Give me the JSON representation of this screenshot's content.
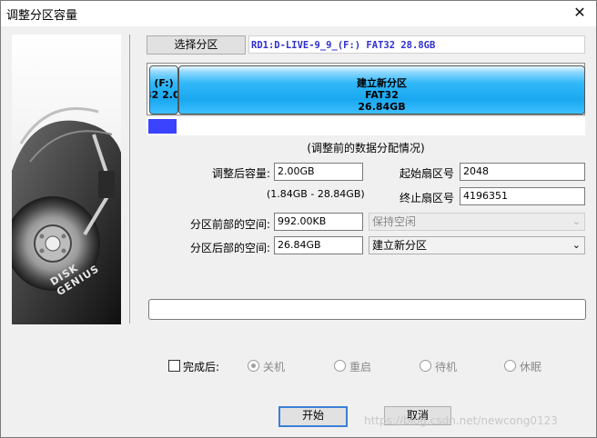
{
  "window": {
    "title": "调整分区容量",
    "close_glyph": "✕"
  },
  "art": {
    "logo_text": "DISK GENIUS"
  },
  "top": {
    "select_partition_label": "选择分区",
    "partition_path": "RD1:D-LIVE-9_9_(F:) FAT32 28.8GB"
  },
  "diskmap": {
    "part1": {
      "line1": "(F:)",
      "line2": "32 2.0"
    },
    "part2": {
      "line1": "建立新分区",
      "line2": "FAT32",
      "line3": "26.84GB"
    },
    "fill_fraction": 0.07,
    "caption": "(调整前的数据分配情况)"
  },
  "form": {
    "adjusted_size_label": "调整后容量:",
    "adjusted_size_value": "2.00GB",
    "range_hint": "(1.84GB - 28.84GB)",
    "start_sector_label": "起始扇区号",
    "start_sector_value": "2048",
    "end_sector_label": "终止扇区号",
    "end_sector_value": "4196351",
    "space_before_label": "分区前部的空间:",
    "space_before_value": "992.00KB",
    "space_before_action": "保持空闲",
    "space_after_label": "分区后部的空间:",
    "space_after_value": "26.84GB",
    "space_after_action": "建立新分区"
  },
  "after": {
    "checkbox_label": "完成后:",
    "opt_shutdown": "关机",
    "opt_restart": "重启",
    "opt_standby": "待机",
    "opt_hibernate": "休眠"
  },
  "buttons": {
    "start": "开始",
    "cancel": "取消"
  },
  "watermark": "https://blog.csdn.net/newcong0123",
  "colors": {
    "partition_fill": "#19a8f0",
    "progress_fill": "#3b43ff",
    "path_text": "#2f2fd0"
  }
}
